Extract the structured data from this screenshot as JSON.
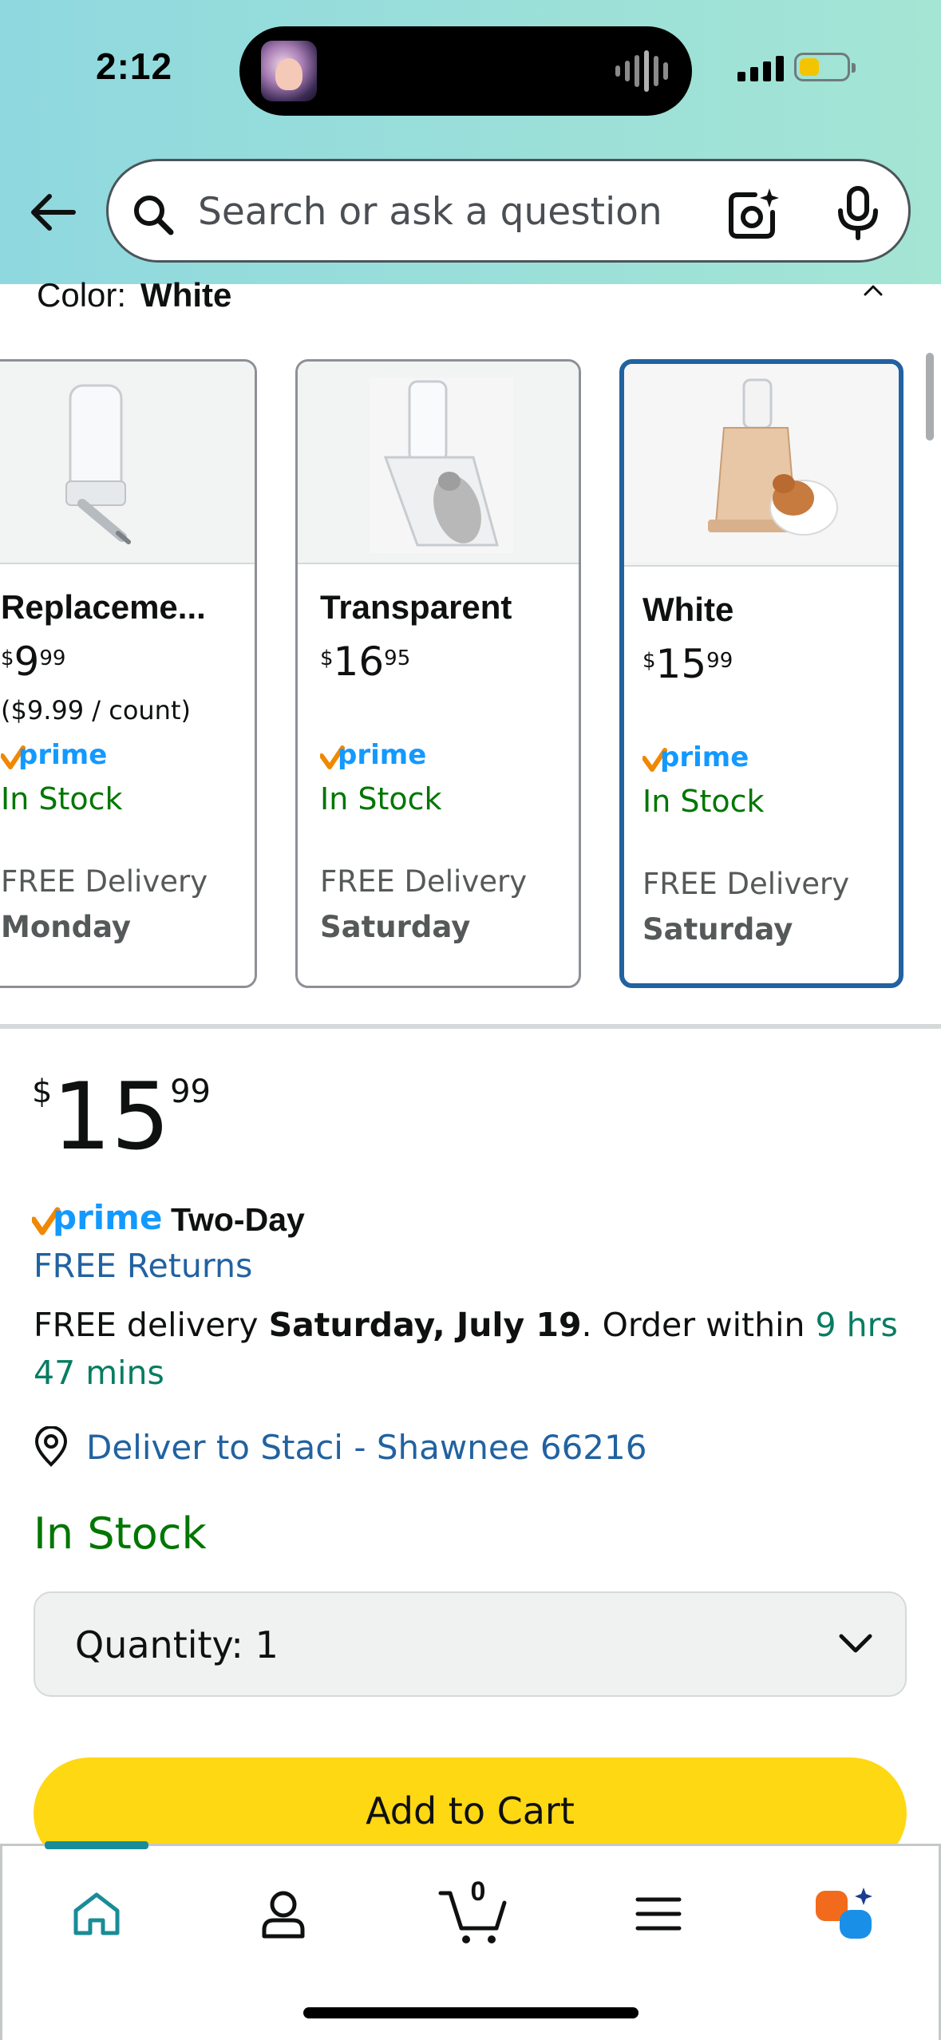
{
  "status_bar": {
    "time": "2:12"
  },
  "search": {
    "placeholder": "Search or ask a question"
  },
  "variant": {
    "label": "Color:",
    "selected": "White",
    "cards": [
      {
        "name": "Replaceme...",
        "price_whole": "9",
        "price_frac": "99",
        "unit_price": "($9.99 / count)",
        "stock": "In Stock",
        "delivery": "FREE Delivery",
        "day": "Monday"
      },
      {
        "name": "Transparent",
        "price_whole": "16",
        "price_frac": "95",
        "unit_price": "",
        "stock": "In Stock",
        "delivery": "FREE Delivery",
        "day": "Saturday"
      },
      {
        "name": "White",
        "price_whole": "15",
        "price_frac": "99",
        "unit_price": "",
        "stock": "In Stock",
        "delivery": "FREE Delivery",
        "day": "Saturday"
      }
    ]
  },
  "currency": "$",
  "buybox": {
    "price_whole": "15",
    "price_frac": "99",
    "prime_label": "prime",
    "shipping_speed": "Two-Day",
    "returns": "FREE Returns",
    "delivery_prefix": "FREE delivery ",
    "delivery_date": "Saturday, July 19",
    "delivery_mid": ". Order within ",
    "delivery_countdown": "9 hrs 47 mins",
    "deliver_to": "Deliver to Staci - Shawnee 66216",
    "stock": "In Stock",
    "quantity_label": "Quantity:",
    "quantity_value": "1",
    "add_to_cart": "Add to Cart"
  },
  "bottom_nav": {
    "cart_count": "0",
    "items": [
      "home-icon",
      "profile-icon",
      "cart-icon",
      "menu-icon",
      "rufus-ai-icon"
    ],
    "active_color": "#1a8c97"
  },
  "colors": {
    "link": "#2162a1",
    "stock_green": "#007600",
    "cart_yellow": "#ffd814",
    "selected_border": "#2162a1"
  }
}
